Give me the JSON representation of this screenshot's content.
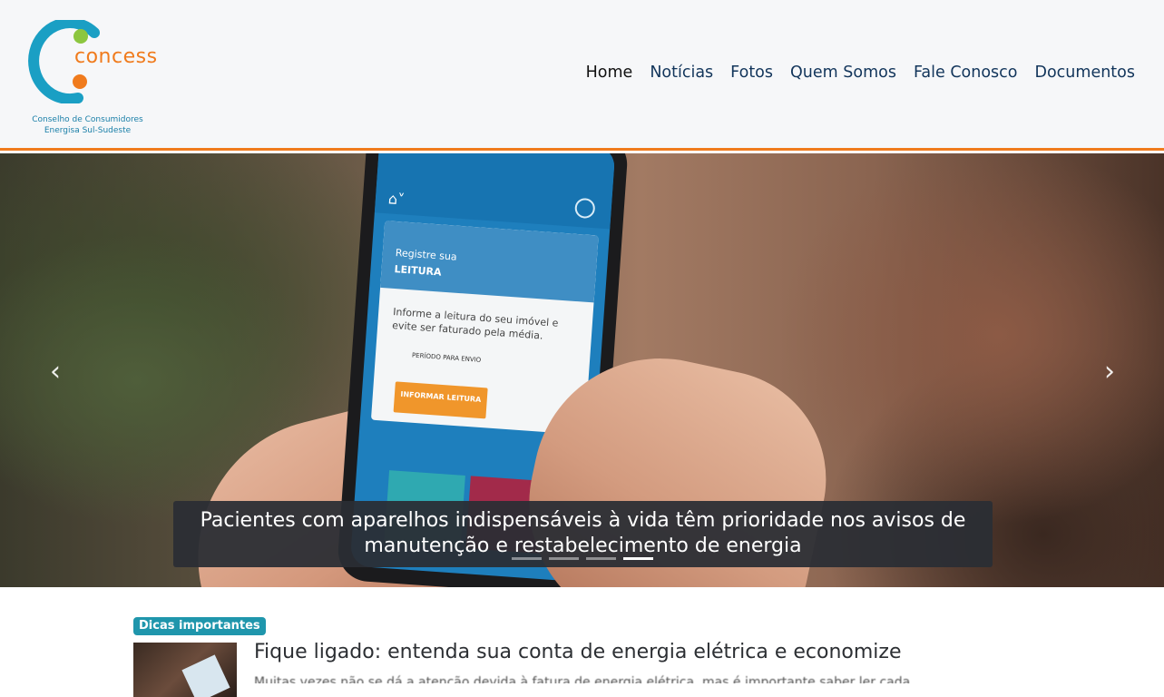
{
  "brand": {
    "name": "concess",
    "subtitle_line1": "Conselho de Consumidores",
    "subtitle_line2": "Energisa Sul-Sudeste",
    "colors": {
      "teal": "#1a9fc4",
      "green": "#8cc63f",
      "orange": "#f07b1d"
    }
  },
  "nav": {
    "items": [
      {
        "label": "Home",
        "active": true
      },
      {
        "label": "Notícias"
      },
      {
        "label": "Fotos"
      },
      {
        "label": "Quem Somos"
      },
      {
        "label": "Fale Conosco"
      },
      {
        "label": "Documentos"
      }
    ]
  },
  "carousel": {
    "caption": "Pacientes com aparelhos indispensáveis à vida têm prioridade nos avisos de manutenção e restabelecimento de energia",
    "prev_icon": "chevron-left-icon",
    "next_icon": "chevron-right-icon",
    "slide_count": 4,
    "active_index": 3,
    "image_screen_text": {
      "card_title_1": "Registre sua",
      "card_title_2": "LEITURA",
      "card_body": "Informe a leitura do seu imóvel e evite ser faturado pela média.",
      "card_period": "PERÍODO PARA ENVIO",
      "card_button": "INFORMAR LEITURA"
    }
  },
  "featured": {
    "badge": "Dicas importantes",
    "title": "Fique ligado: entenda sua conta de energia elétrica e economize",
    "excerpt": "Muitas vezes não se dá a atenção devida à fatura de energia elétrica, mas é importante saber ler cada"
  }
}
